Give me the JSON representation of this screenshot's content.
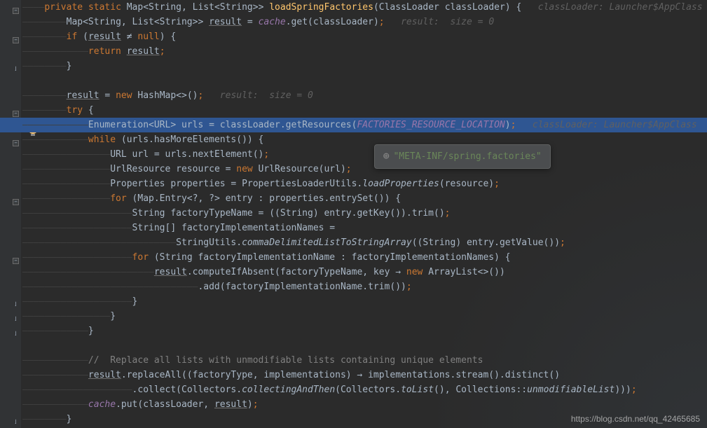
{
  "code": {
    "l1_private": "private",
    "l1_static": "static",
    "l1_type": " Map<String, List<String>> ",
    "l1_method": "loadSpringFactories",
    "l1_params": "(ClassLoader classLoader) {   ",
    "l1_hint": "classLoader: Launcher$AppClass",
    "l2_a": "Map<String, List<String>> ",
    "l2_result": "result",
    "l2_b": " = ",
    "l2_cache": "cache",
    "l2_c": ".get(classLoader)",
    "l2_semicolon": ";",
    "l2_hint": "   result:  size = 0",
    "l3_if": "if",
    "l3_a": " (",
    "l3_result": "result",
    "l3_b": " ",
    "l3_neq": "≠",
    "l3_c": " ",
    "l3_null": "null",
    "l3_d": ") {",
    "l4_return": "return",
    "l4_a": " ",
    "l4_result": "result",
    "l4_semicolon": ";",
    "l5_brace": "}",
    "l7_result": "result",
    "l7_a": " = ",
    "l7_new": "new",
    "l7_b": " HashMap<>()",
    "l7_semicolon": ";",
    "l7_hint": "   result:  size = 0",
    "l8_try": "try",
    "l8_a": " {",
    "l9_a": "Enumeration<URL> urls = classLoader.getResources(",
    "l9_const": "FACTORIES_RESOURCE_LOCATION",
    "l9_b": ")",
    "l9_semicolon": ";",
    "l9_hint": "   classLoader: Launcher$AppClass",
    "l10_while": "while",
    "l10_a": " (urls.hasMoreElements()) {",
    "l11_a": "URL url = urls.nextElement()",
    "l11_semicolon": ";",
    "l12_a": "UrlResource resource = ",
    "l12_new": "new",
    "l12_b": " UrlResource(url)",
    "l12_semicolon": ";",
    "l13_a": "Properties properties = PropertiesLoaderUtils.",
    "l13_static": "loadProperties",
    "l13_b": "(resource)",
    "l13_semicolon": ";",
    "l14_for": "for",
    "l14_a": " (Map.Entry<?, ?> entry : properties.entrySet()) {",
    "l15_a": "String factoryTypeName = ((String) entry.getKey()).trim()",
    "l15_semicolon": ";",
    "l16_a": "String[] factoryImplementationNames =",
    "l17_a": "StringUtils.",
    "l17_static": "commaDelimitedListToStringArray",
    "l17_b": "((String) entry.getValue())",
    "l17_semicolon": ";",
    "l18_for": "for",
    "l18_a": " (String factoryImplementationName : factoryImplementationNames) {",
    "l19_result": "result",
    "l19_a": ".computeIfAbsent(factoryTypeName, key → ",
    "l19_new": "new",
    "l19_b": " ArrayList<>())",
    "l20_a": ".add(factoryImplementationName.trim())",
    "l20_semicolon": ";",
    "l21_brace": "}",
    "l22_brace": "}",
    "l23_brace": "}",
    "l25_comment": "//  Replace all lists with unmodifiable lists containing unique elements",
    "l26_result": "result",
    "l26_a": ".replaceAll((factoryType, implementations) → implementations.stream().distinct()",
    "l27_a": ".collect(Collectors.",
    "l27_static1": "collectingAndThen",
    "l27_b": "(Collectors.",
    "l27_static2": "toList",
    "l27_c": "(), Collections::",
    "l27_static3": "unmodifiableList",
    "l27_d": ")))",
    "l27_semicolon": ";",
    "l28_cache": "cache",
    "l28_a": ".put(classLoader, ",
    "l28_result": "result",
    "l28_b": ")",
    "l28_semicolon": ";",
    "l29_brace": "}"
  },
  "tooltip": {
    "plus": "⊕",
    "text": "\"META-INF/spring.factories\""
  },
  "watermark": "https://blog.csdn.net/qq_42465685"
}
